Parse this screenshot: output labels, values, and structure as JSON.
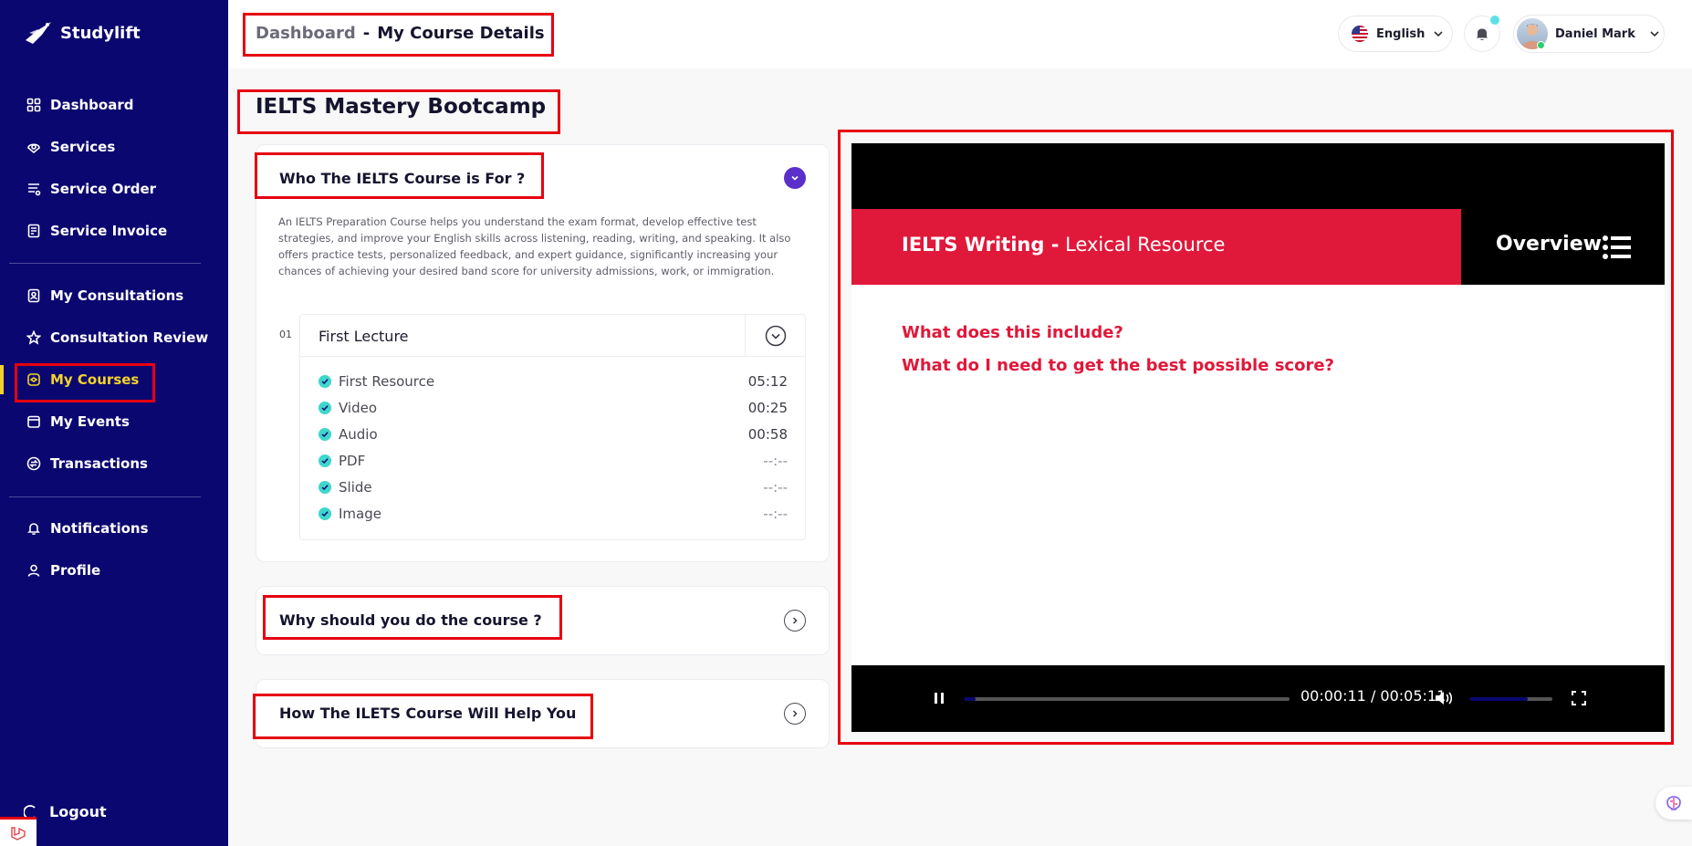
{
  "brand": {
    "name": "Studylift"
  },
  "sidebar": {
    "items": [
      {
        "label": "Dashboard",
        "icon": "dashboard-icon"
      },
      {
        "label": "Services",
        "icon": "services-icon"
      },
      {
        "label": "Service Order",
        "icon": "service-order-icon"
      },
      {
        "label": "Service Invoice",
        "icon": "invoice-icon"
      },
      {
        "label": "My Consultations",
        "icon": "consultations-icon"
      },
      {
        "label": "Consultation Review",
        "icon": "star-icon"
      },
      {
        "label": "My Courses",
        "icon": "courses-icon",
        "active": true
      },
      {
        "label": "My Events",
        "icon": "calendar-icon"
      },
      {
        "label": "Transactions",
        "icon": "transactions-icon"
      },
      {
        "label": "Notifications",
        "icon": "bell-icon"
      },
      {
        "label": "Profile",
        "icon": "user-icon"
      }
    ],
    "logout": "Logout"
  },
  "header": {
    "breadcrumb_root": "Dashboard",
    "breadcrumb_sep": "-",
    "breadcrumb_current": "My Course Details",
    "language": "English",
    "user_name": "Daniel Mark"
  },
  "course": {
    "title": "IELTS Mastery Bootcamp",
    "sections": [
      {
        "title": "Who The IELTS Course is For ?",
        "expanded": true,
        "description": "An IELTS Preparation Course helps you understand the exam format, develop effective test strategies, and improve your English skills across listening, reading, writing, and speaking. It also offers practice tests, personalized feedback, and expert guidance, significantly increasing your chances of achieving your desired band score for university admissions, work, or immigration."
      },
      {
        "title": "Why should you do the course ?",
        "expanded": false
      },
      {
        "title": "How The ILETS Course Will Help You",
        "expanded": false
      }
    ],
    "lecture": {
      "number": "01",
      "title": "First Lecture",
      "resources": [
        {
          "name": "First Resource",
          "duration": "05:12"
        },
        {
          "name": "Video",
          "duration": "00:25"
        },
        {
          "name": "Audio",
          "duration": "00:58"
        },
        {
          "name": "PDF",
          "duration": "--:--"
        },
        {
          "name": "Slide",
          "duration": "--:--"
        },
        {
          "name": "Image",
          "duration": "--:--"
        }
      ]
    }
  },
  "video": {
    "banner_bold": "IELTS Writing -",
    "banner_light": "Lexical Resource",
    "overview": "Overview",
    "questions": [
      "What does this include?",
      "What do I need to get the best possible score?"
    ],
    "time_display": "00:00:11 / 00:05:11",
    "progress": 0.035,
    "volume": 0.7
  },
  "colors": {
    "sidebar_bg": "#0b0770",
    "active_nav": "#f3d32b",
    "accent_purple": "#5b2fc9",
    "check": "#3fd6cc",
    "slide_red": "#e0183a",
    "highlight": "#e60010"
  }
}
